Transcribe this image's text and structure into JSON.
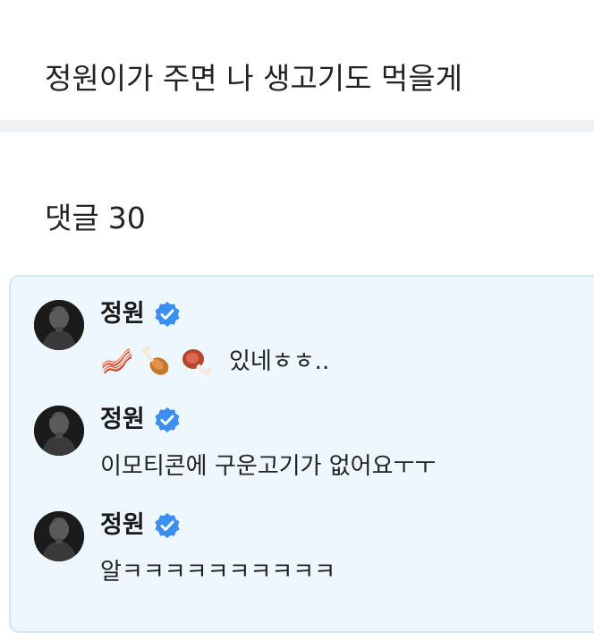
{
  "post": {
    "text": "정원이가 주면 나 생고기도 먹을게"
  },
  "comments_header": {
    "label": "댓글",
    "count": "30"
  },
  "comments": [
    {
      "author": "정원",
      "verified": true,
      "emojis": [
        "bacon-emoji",
        "poultry-leg-emoji",
        "meat-on-bone-emoji"
      ],
      "text": "있네ㅎㅎ.."
    },
    {
      "author": "정원",
      "verified": true,
      "text": "이모티콘에 구운고기가 없어요ㅜㅜ"
    },
    {
      "author": "정원",
      "verified": true,
      "text": "알ㅋㅋㅋㅋㅋㅋㅋㅋㅋㅋ"
    }
  ],
  "colors": {
    "panel_bg": "#eef7fd",
    "panel_border": "#cfe6f5",
    "verified_badge": "#3b8ff0",
    "divider": "#f1f2f4"
  }
}
